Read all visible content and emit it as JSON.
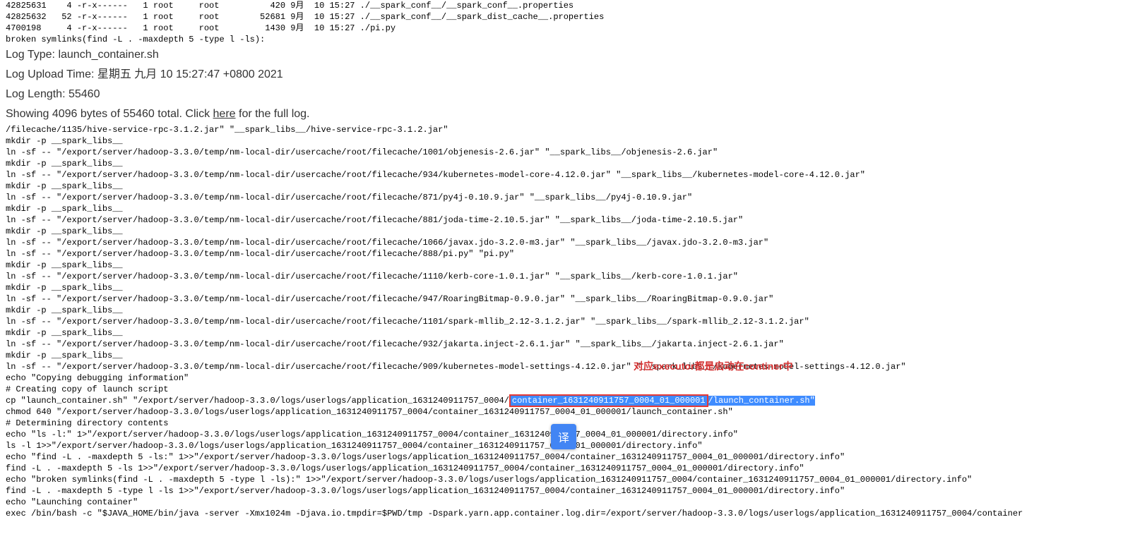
{
  "top_listing": [
    "42825631    4 -r-x------   1 root     root          420 9月  10 15:27 ./__spark_conf__/__spark_conf__.properties",
    "42825632   52 -r-x------   1 root     root        52681 9月  10 15:27 ./__spark_conf__/__spark_dist_cache__.properties",
    "4700198     4 -r-x------   1 root     root         1430 9月  10 15:27 ./pi.py",
    "broken symlinks(find -L . -maxdepth 5 -type l -ls):"
  ],
  "meta": {
    "log_type_label": "Log Type: ",
    "log_type_value": "launch_container.sh",
    "log_upload_label": "Log Upload Time: ",
    "log_upload_value": "星期五 九月 10 15:27:47 +0800 2021",
    "log_length_label": "Log Length: ",
    "log_length_value": "55460",
    "showing_prefix": "Showing 4096 bytes of 55460 total. Click ",
    "here_link": "here",
    "showing_suffix": " for the full log."
  },
  "body_lines_1": [
    "/filecache/1135/hive-service-rpc-3.1.2.jar\" \"__spark_libs__/hive-service-rpc-3.1.2.jar\"",
    "mkdir -p __spark_libs__",
    "ln -sf -- \"/export/server/hadoop-3.3.0/temp/nm-local-dir/usercache/root/filecache/1001/objenesis-2.6.jar\" \"__spark_libs__/objenesis-2.6.jar\"",
    "mkdir -p __spark_libs__",
    "ln -sf -- \"/export/server/hadoop-3.3.0/temp/nm-local-dir/usercache/root/filecache/934/kubernetes-model-core-4.12.0.jar\" \"__spark_libs__/kubernetes-model-core-4.12.0.jar\"",
    "mkdir -p __spark_libs__",
    "ln -sf -- \"/export/server/hadoop-3.3.0/temp/nm-local-dir/usercache/root/filecache/871/py4j-0.10.9.jar\" \"__spark_libs__/py4j-0.10.9.jar\"",
    "mkdir -p __spark_libs__",
    "ln -sf -- \"/export/server/hadoop-3.3.0/temp/nm-local-dir/usercache/root/filecache/881/joda-time-2.10.5.jar\" \"__spark_libs__/joda-time-2.10.5.jar\"",
    "mkdir -p __spark_libs__",
    "ln -sf -- \"/export/server/hadoop-3.3.0/temp/nm-local-dir/usercache/root/filecache/1066/javax.jdo-3.2.0-m3.jar\" \"__spark_libs__/javax.jdo-3.2.0-m3.jar\"",
    "ln -sf -- \"/export/server/hadoop-3.3.0/temp/nm-local-dir/usercache/root/filecache/888/pi.py\" \"pi.py\"",
    "mkdir -p __spark_libs__",
    "ln -sf -- \"/export/server/hadoop-3.3.0/temp/nm-local-dir/usercache/root/filecache/1110/kerb-core-1.0.1.jar\" \"__spark_libs__/kerb-core-1.0.1.jar\"",
    "mkdir -p __spark_libs__",
    "ln -sf -- \"/export/server/hadoop-3.3.0/temp/nm-local-dir/usercache/root/filecache/947/RoaringBitmap-0.9.0.jar\" \"__spark_libs__/RoaringBitmap-0.9.0.jar\"",
    "mkdir -p __spark_libs__",
    "ln -sf -- \"/export/server/hadoop-3.3.0/temp/nm-local-dir/usercache/root/filecache/1101/spark-mllib_2.12-3.1.2.jar\" \"__spark_libs__/spark-mllib_2.12-3.1.2.jar\"",
    "mkdir -p __spark_libs__",
    "ln -sf -- \"/export/server/hadoop-3.3.0/temp/nm-local-dir/usercache/root/filecache/932/jakarta.inject-2.6.1.jar\" \"__spark_libs__/jakarta.inject-2.6.1.jar\"",
    "mkdir -p __spark_libs__"
  ],
  "annot_line": {
    "text": "ln -sf -- \"/export/server/hadoop-3.3.0/temp/nm-local-dir/usercache/root/filecache/909/kubernetes-model-settings-4.12.0.jar\" \"__spark_libs__/kubernetes-model-settings-4.12.0.jar\"",
    "overlay": "对应executor都是启动在continer中"
  },
  "body_lines_2": [
    "echo \"Copying debugging information\"",
    "# Creating copy of launch script"
  ],
  "cp_line": {
    "prefix": "cp \"launch_container.sh\" \"/export/server/hadoop-3.3.0/logs/userlogs/application_1631240911757_0004/",
    "boxed": "container_1631240911757_0004_01_000001",
    "sel_suffix": "/launch_container.sh\""
  },
  "body_lines_3": [
    "chmod 640 \"/export/server/hadoop-3.3.0/logs/userlogs/application_1631240911757_0004/container_1631240911757_0004_01_000001/launch_container.sh\"",
    "# Determining directory contents",
    "echo \"ls -l:\" 1>\"/export/server/hadoop-3.3.0/logs/userlogs/application_1631240911757_0004/container_1631240911757_0004_01_000001/directory.info\"",
    "ls -l 1>>\"/export/server/hadoop-3.3.0/logs/userlogs/application_1631240911757_0004/container_1631240911757_0004_01_000001/directory.info\"",
    "echo \"find -L . -maxdepth 5 -ls:\" 1>>\"/export/server/hadoop-3.3.0/logs/userlogs/application_1631240911757_0004/container_1631240911757_0004_01_000001/directory.info\"",
    "find -L . -maxdepth 5 -ls 1>>\"/export/server/hadoop-3.3.0/logs/userlogs/application_1631240911757_0004/container_1631240911757_0004_01_000001/directory.info\"",
    "echo \"broken symlinks(find -L . -maxdepth 5 -type l -ls):\" 1>>\"/export/server/hadoop-3.3.0/logs/userlogs/application_1631240911757_0004/container_1631240911757_0004_01_000001/directory.info\"",
    "find -L . -maxdepth 5 -type l -ls 1>>\"/export/server/hadoop-3.3.0/logs/userlogs/application_1631240911757_0004/container_1631240911757_0004_01_000001/directory.info\"",
    "echo \"Launching container\"",
    "exec /bin/bash -c \"$JAVA_HOME/bin/java -server -Xmx1024m -Djava.io.tmpdir=$PWD/tmp -Dspark.yarn.app.container.log.dir=/export/server/hadoop-3.3.0/logs/userlogs/application_1631240911757_0004/container"
  ],
  "translate_label": "译"
}
